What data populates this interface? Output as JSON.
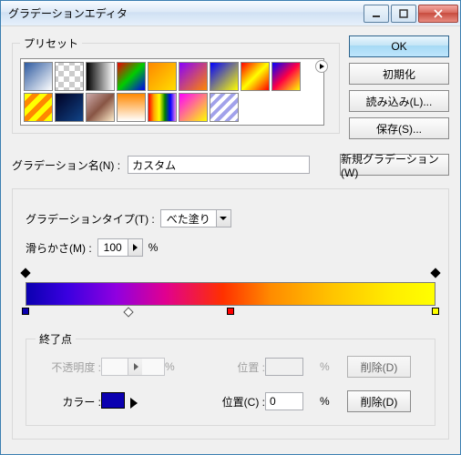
{
  "window": {
    "title": "グラデーションエディタ"
  },
  "sidebar": {
    "ok": "OK",
    "init": "初期化",
    "load": "読み込み(L)...",
    "save": "保存(S)..."
  },
  "presets": {
    "legend": "プリセット"
  },
  "name_row": {
    "label": "グラデーション名(N) :",
    "value": "カスタム",
    "new_btn": "新規グラデーション(W)"
  },
  "editor": {
    "type_label": "グラデーションタイプ(T) :",
    "type_value": "べた塗り",
    "smooth_label": "滑らかさ(M) :",
    "smooth_value": "100",
    "percent": "%"
  },
  "gradient": {
    "opacity_stops": [
      0,
      100
    ],
    "color_stops": [
      {
        "pos": 0,
        "color": "#0b00b0"
      },
      {
        "pos": 50,
        "color": "#ff0000"
      },
      {
        "pos": 100,
        "color": "#ffff00"
      }
    ],
    "midpoints": [
      25
    ]
  },
  "endpoint": {
    "legend": "終了点",
    "opacity_label": "不透明度 :",
    "opacity_value": "",
    "pos1_label": "位置 :",
    "pos1_value": "",
    "delete1": "削除(D)",
    "color_label": "カラー :",
    "color_value": "#0b00b0",
    "pos2_label": "位置(C) :",
    "pos2_value": "0",
    "delete2": "削除(D)",
    "percent": "%"
  }
}
